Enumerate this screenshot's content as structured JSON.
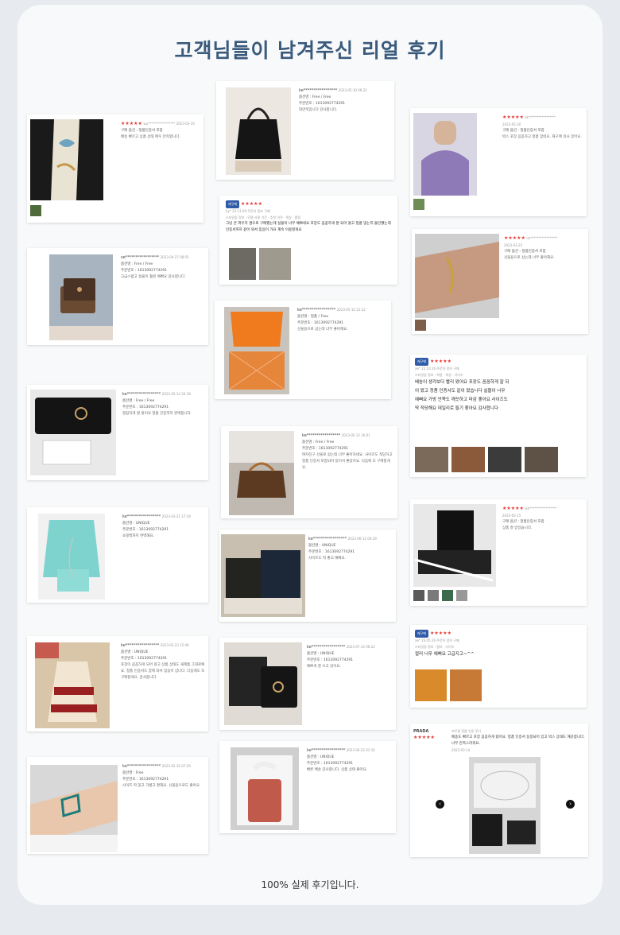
{
  "title": "고객님들이 남겨주신 리얼 후기",
  "footer": "100% 실제 후기입니다.",
  "colors": {
    "title": "#3a5a7c",
    "stars": "#e53935",
    "badge": "#2f5ba8"
  },
  "stars_text": "★★★★★",
  "reviews": {
    "c1": {
      "id": "wu*****************",
      "date": "2023-03-19",
      "meta": "구매 옵션 : 정품인증서 포함",
      "body": "배송 빠르고 상품 상태 매우 만족합니다."
    },
    "c2": {
      "id": "ke*****************",
      "date": "2023-05-10 06:22",
      "meta": "옵션명 : Free / Free",
      "meta2": "주문번호 : 1613092774291",
      "body": "대만족입니다 감사합니다."
    },
    "c3": {
      "id": "ek*****************",
      "date": "2023-05-30",
      "meta": "구매 옵션 : 정품인증서 포함",
      "body": "박스 포장 꼼꼼하고 정품 맞네요. 재구매 의사 있어요."
    },
    "c4": {
      "badge": "재구매",
      "line1": "hy*   22.11.09   주문자 정보 구매",
      "line2": "스타일링 정보 : 모델 사용 기간 · 추천 의견 · 색상 · 평점",
      "text": "그냥 큰 파우치 겸으로 구매했는데 실물이 너무 예쁘네요 포장도 꼼꼼하게 잘 되어 왔고 정품 맞는지 불안했는데 인증서까지 같이 와서 믿음이 가요 계속 이용할게요"
    },
    "c5": {
      "id": "se*****************",
      "date": "2023-04-27 08:55",
      "meta": "옵션명 : Free / Free",
      "meta2": "주문번호 : 1613092774291",
      "body": "고급스럽고 실물이 훨씬 예뻐요 감사합니다."
    },
    "c6": {
      "id": "im*****************",
      "date": "2023-03-22",
      "meta": "구매 옵션 : 정품인증서 포함",
      "body": "선물용으로 샀는데 너무 좋아해요."
    },
    "c7": {
      "id": "ke*****************",
      "date": "2023-05-10 22:22",
      "meta": "옵션명 : 정품 / Free",
      "meta2": "주문번호 : 1613092774291",
      "body": "선물용으로 샀는데 너무 좋아해요."
    },
    "c8": {
      "badge": "재구매",
      "line1": "ae*   22.10.16   주문자 정보 구매",
      "line2": "스타일링 정보 : 착용 · 색상 · 사이즈",
      "text": "배송이 생각보다 빨리 왔어요 포장도 꼼꼼하게 잘 되어 왔고 정품 인증서도 같이 왔습니다 실물이 너무 예뻐요 가방 안쪽도 깨끗하고 마감 좋아요 사이즈도 딱 적당해요 데일리로 들기 좋아요 감사합니다"
    },
    "c9": {
      "id": "ke*****************",
      "date": "2023-02-14 20:18",
      "meta": "옵션명 : Free / Free",
      "meta2": "주문번호 : 1613092774291",
      "body": "깔끔하게 잘 왔어요 정품 인증까지 완벽합니다."
    },
    "c10": {
      "id": "ke*****************",
      "date": "2023-05-12 16:01",
      "meta": "옵션명 : Free / Free",
      "meta2": "주문번호 : 1613092774291",
      "body": "여자친구 선물로 샀는데 너무 좋아하네요. 사이즈도 적당하고 정품 인증서 포함되어 있어서 좋았어요. 다음에 또 구매할게요."
    },
    "c11": {
      "id": "ke*****************",
      "date": "2023-03-21 17:19",
      "meta": "옵션명 : UNIQUE",
      "meta2": "주문번호 : 1613092774291",
      "body": "쇼핑백까지 완벽해요."
    },
    "c12": {
      "id": "wh*****************",
      "date": "2023-03-15",
      "meta": "구매 옵션 : 정품인증서 포함",
      "body": "상품 잘 받았습니다."
    },
    "c13": {
      "id": "ke*****************",
      "date": "2023-06-12 00:29",
      "meta": "옵션명 : UNIQUE",
      "meta2": "주문번호 : 1613092774291",
      "body": "사이즈도 딱 좋고 예뻐요."
    },
    "c14": {
      "badge": "재구매",
      "line1": "ae*   23.05.16   주문자 정보 구매",
      "line2": "스타일링 정보 : 컬러 · 사이즈",
      "text": "컬러 너무 예뻐요 고급지고~^^"
    },
    "c15": {
      "id": "ke*****************",
      "date": "2023-03-23 15:46",
      "meta": "옵션명 : UNIQUE",
      "meta2": "주문번호 : 1613092774291",
      "body": "포장이 꼼꼼하게 되어 왔고 상품 상태도 새제품 그대로예요. 정품 인증서도 함께 와서 믿음이 갑니다. 다음에도 또 구매할게요. 감사합니다."
    },
    "c16": {
      "id": "ke*****************",
      "date": "2023-07-12 06:22",
      "meta": "옵션명 : UNIQUE",
      "meta2": "주문번호 : 1613092774291",
      "body": "예쁘게 잘 쓰고 있어요."
    },
    "c17": {
      "brand": "PRADA",
      "user": "프로필   정품 인증 후기",
      "text": "배송도 빠르고 포장 꼼꼼하게 왔어요. 정품 인증서 동봉되어 있고 박스 상태도 깨끗합니다. 너무 만족스러워요.",
      "date": "2023-03-14"
    },
    "c18": {
      "id": "ke*****************",
      "date": "2023-02-10 07:29",
      "meta": "옵션명 : Free",
      "meta2": "주문번호 : 1613092774291",
      "body": "사이즈 딱 맞고 가볍고 편해요. 선물용으로도 좋아요."
    },
    "c19": {
      "id": "ke*****************",
      "date": "2023-06-22 01:16",
      "meta": "옵션명 : UNIQUE",
      "meta2": "주문번호 : 1613092774291",
      "body": "빠른 배송 감사합니다. 상품 상태 좋아요."
    }
  }
}
